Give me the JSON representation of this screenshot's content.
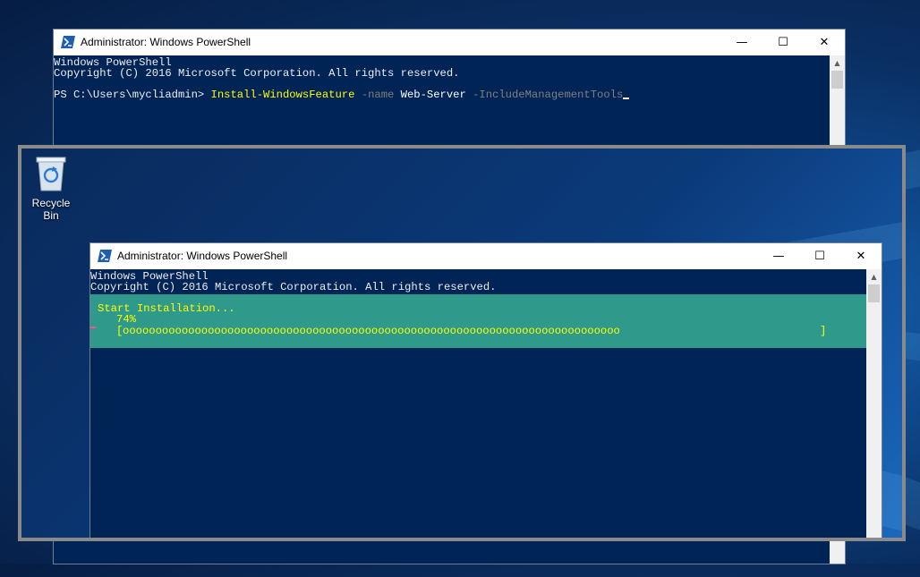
{
  "background_window": {
    "title": "Administrator: Windows PowerShell",
    "console": {
      "line1": "Windows PowerShell",
      "line2": "Copyright (C) 2016 Microsoft Corporation. All rights reserved.",
      "prompt": "PS C:\\Users\\mycliadmin> ",
      "command": "Install-WindowsFeature",
      "param1": " -name",
      "value1": " Web-Server",
      "param2": " -IncludeManagementTools"
    }
  },
  "desktop": {
    "recycle_bin_label": "Recycle Bin"
  },
  "foreground_window": {
    "title": "Administrator: Windows PowerShell",
    "console": {
      "line1": "Windows PowerShell",
      "line2": "Copyright (C) 2016 Microsoft Corporation. All rights reserved."
    },
    "progress": {
      "status": "Start Installation...",
      "percent_label": "74%",
      "bar_open": "[",
      "bar_fill": "oooooooooooooooooooooooooooooooooooooooooooooooooooooooooooooooooooooooooooo",
      "bar_close": "]",
      "percent": 74
    }
  },
  "window_controls": {
    "minimize": "—",
    "maximize": "☐",
    "close": "✕"
  },
  "colors": {
    "console_bg": "#012456",
    "progress_bg": "#2f9a8b",
    "progress_text": "#ffff00",
    "command_yellow": "#ffff00",
    "param_gray": "#808080"
  }
}
